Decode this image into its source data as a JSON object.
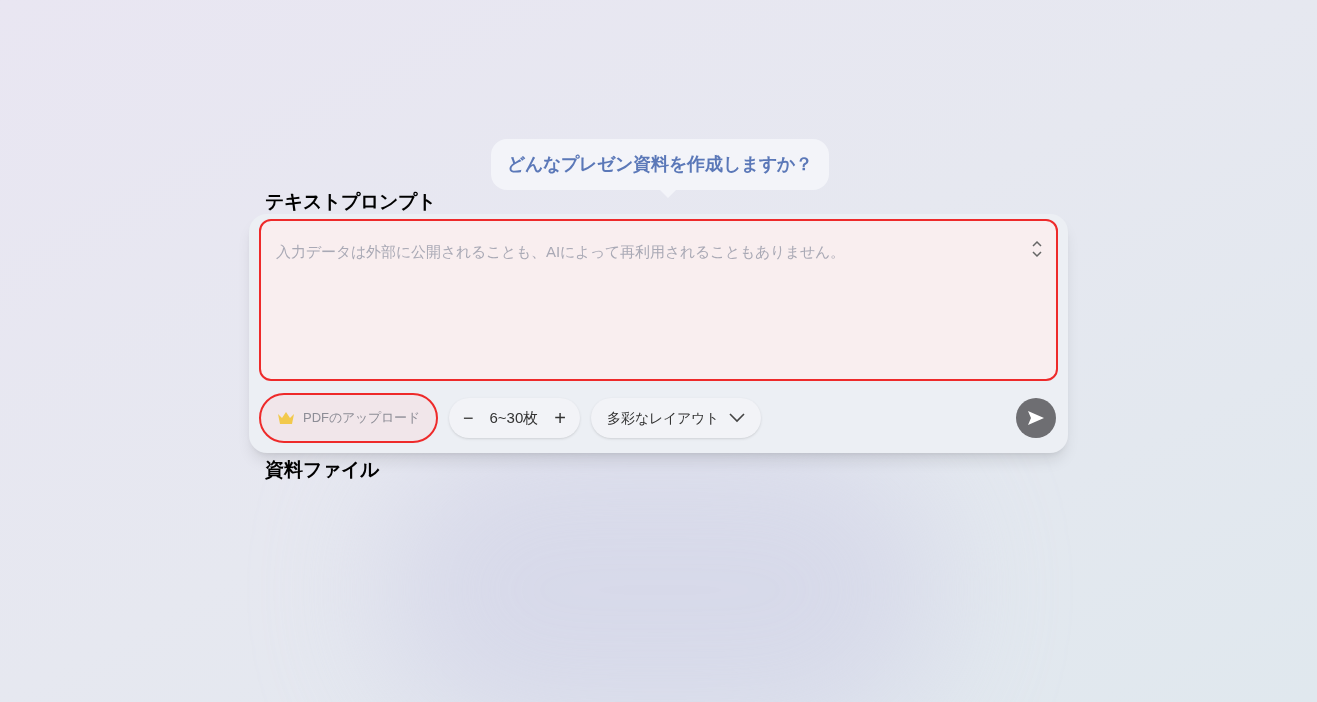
{
  "prompt_bubble": {
    "text": "どんなプレゼン資料を作成しますか？"
  },
  "annotations": [
    {
      "label": "テキストプロンプト"
    },
    {
      "label": "資料ファイル"
    }
  ],
  "prompt_field": {
    "placeholder": "入力データは外部に公開されることも、AIによって再利用されることもありません。",
    "highlighted": true
  },
  "upload_button": {
    "label": "PDFのアップロード",
    "highlighted": true
  },
  "slide_count": {
    "decrease": "−",
    "value": "6~30枚",
    "increase": "+"
  },
  "layout_dropdown": {
    "label": "多彩なレイアウト"
  }
}
